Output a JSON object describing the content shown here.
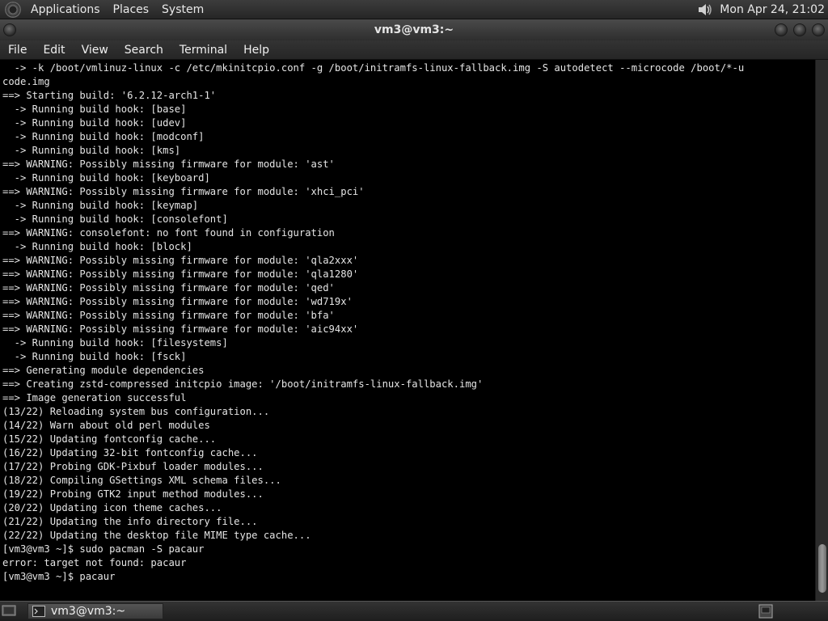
{
  "top_panel": {
    "menus": [
      "Applications",
      "Places",
      "System"
    ],
    "clock": "Mon Apr 24, 21:02",
    "icons": {
      "logo": "gnome-foot-icon",
      "volume": "volume-icon"
    }
  },
  "window": {
    "title": "vm3@vm3:~",
    "menu": [
      "File",
      "Edit",
      "View",
      "Search",
      "Terminal",
      "Help"
    ]
  },
  "terminal": {
    "lines": [
      "  -> -k /boot/vmlinuz-linux -c /etc/mkinitcpio.conf -g /boot/initramfs-linux-fallback.img -S autodetect --microcode /boot/*-u",
      "code.img",
      "==> Starting build: '6.2.12-arch1-1'",
      "  -> Running build hook: [base]",
      "  -> Running build hook: [udev]",
      "  -> Running build hook: [modconf]",
      "  -> Running build hook: [kms]",
      "==> WARNING: Possibly missing firmware for module: 'ast'",
      "  -> Running build hook: [keyboard]",
      "==> WARNING: Possibly missing firmware for module: 'xhci_pci'",
      "  -> Running build hook: [keymap]",
      "  -> Running build hook: [consolefont]",
      "==> WARNING: consolefont: no font found in configuration",
      "  -> Running build hook: [block]",
      "==> WARNING: Possibly missing firmware for module: 'qla2xxx'",
      "==> WARNING: Possibly missing firmware for module: 'qla1280'",
      "==> WARNING: Possibly missing firmware for module: 'qed'",
      "==> WARNING: Possibly missing firmware for module: 'wd719x'",
      "==> WARNING: Possibly missing firmware for module: 'bfa'",
      "==> WARNING: Possibly missing firmware for module: 'aic94xx'",
      "  -> Running build hook: [filesystems]",
      "  -> Running build hook: [fsck]",
      "==> Generating module dependencies",
      "==> Creating zstd-compressed initcpio image: '/boot/initramfs-linux-fallback.img'",
      "==> Image generation successful",
      "(13/22) Reloading system bus configuration...",
      "(14/22) Warn about old perl modules",
      "(15/22) Updating fontconfig cache...",
      "(16/22) Updating 32-bit fontconfig cache...",
      "(17/22) Probing GDK-Pixbuf loader modules...",
      "(18/22) Compiling GSettings XML schema files...",
      "(19/22) Probing GTK2 input method modules...",
      "(20/22) Updating icon theme caches...",
      "(21/22) Updating the info directory file...",
      "(22/22) Updating the desktop file MIME type cache...",
      "[vm3@vm3 ~]$ sudo pacman -S pacaur",
      "error: target not found: pacaur",
      "[vm3@vm3 ~]$ pacaur"
    ]
  },
  "taskbar": {
    "window_button": "vm3@vm3:~",
    "icons": {
      "show_desktop": "show-desktop-icon",
      "task": "terminal-icon",
      "tray": "workspace-icon"
    }
  }
}
